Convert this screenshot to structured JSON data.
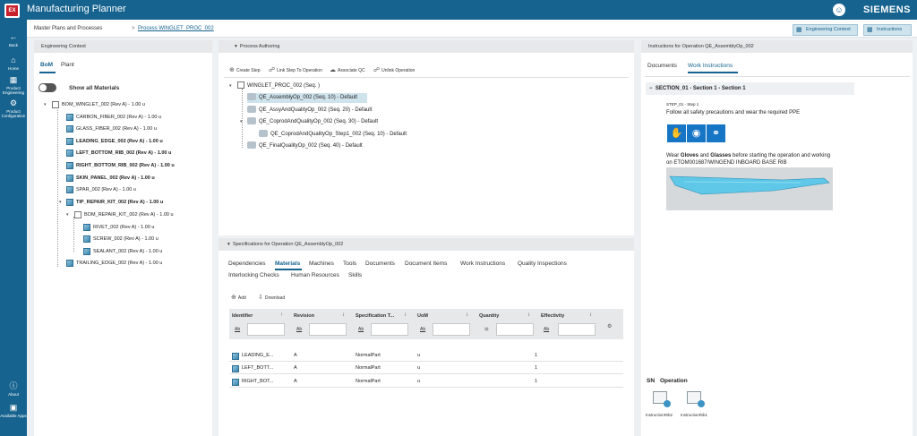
{
  "app": {
    "logo_text": "EX",
    "title": "Manufacturing Planner",
    "brand": "SIEMENS",
    "user_icon": "user-icon"
  },
  "rail": {
    "back": "Back",
    "home": "Home",
    "product_engineering": "Product Engineering",
    "product_configuration": "Product Configuration",
    "about": "About",
    "available_apps": "Available Apps"
  },
  "breadcrumb": {
    "root": "Master Plans and Processes",
    "separator": ">",
    "current": "Process WINGLET_PROC_002"
  },
  "top_buttons": {
    "engineering_context": "Engineering Context",
    "instructions": "Instructions"
  },
  "engineering_context": {
    "title": "Engineering Context",
    "tabs": [
      "BoM",
      "Plant"
    ],
    "active_tab": "BoM",
    "show_all_materials": "Show all Materials",
    "tree": [
      "BOM_WINGLET_002 (Rev A) - 1.00 u",
      "CARBON_FIBER_002 (Rev A) - 1.00 u",
      "GLASS_FIBER_002 (Rev A) - 1.00 u",
      "LEADING_EDGE_002 (Rev A) - 1.00 u",
      "LEFT_BOTTOM_RIB_002 (Rev A) - 1.00 u",
      "RIGHT_BOTTOM_RIB_002 (Rev A) - 1.00 u",
      "SKIN_PANEL_002 (Rev A) - 1.00 u",
      "SPAR_002 (Rev A) - 1.00 u",
      "TIP_REPAIR_KIT_002 (Rev A) - 1.00 u",
      "BOM_REPAIR_KIT_002 (Rev A) - 1.00 u",
      "RIVET_002 (Rev A) - 1.00 u",
      "SCREW_002 (Rev A) - 1.00 u",
      "SEALANT_002 (Rev A) - 1.00 u",
      "TRAILING_EDGE_002 (Rev A) - 1.00 u"
    ]
  },
  "process_authoring": {
    "title": "Process Authoring",
    "toolbar": [
      "Create Step",
      "Link Step To Operation",
      "Associate QC",
      "Unlink Operation"
    ],
    "tree": [
      "WINGLET_PROC_002 (Seq. )",
      "QE_AssemblyOp_002 (Seq. 10) - Default",
      "QE_AssyAndQualityOp_002 (Seq. 20) - Default",
      "QE_CoprodAndQualityOp_002 (Seq. 30) - Default",
      "QE_CoprodAndQualityOp_Step1_002 (Seq. 10) - Default",
      "QE_FinalQualityOp_002 (Seq. 40) - Default"
    ]
  },
  "specifications": {
    "title": "Specifications for Operation QE_AssemblyOp_002",
    "tabs": [
      "Dependencies",
      "Materials",
      "Machines",
      "Tools",
      "Documents",
      "Document Items",
      "Work Instructions",
      "Quality Inspections",
      "Interlocking Checks",
      "Human Resources",
      "Skills"
    ],
    "active_tab": "Materials",
    "actions": [
      "Add",
      "Download"
    ],
    "filter_label": "Ab",
    "columns": [
      "Identifier",
      "Revision",
      "Specification T...",
      "UoM",
      "Quantity",
      "Effectivity"
    ],
    "rows": [
      [
        "LEADING_E...",
        "A",
        "NormalPart",
        "u",
        "1",
        ""
      ],
      [
        "LEFT_BOTT...",
        "A",
        "NormalPart",
        "u",
        "1",
        ""
      ],
      [
        "RIGHT_BOT...",
        "A",
        "NormalPart",
        "u",
        "1",
        ""
      ]
    ]
  },
  "instructions": {
    "title": "Instructions for Operation QE_AssemblyOp_002",
    "tabs": [
      "Documents",
      "Work Instructions"
    ],
    "active_tab": "Work Instructions",
    "section": "SECTION_01 - Section 1 - Section 1",
    "step_label": "STEP_01 - Step 1",
    "step_text": "Follow all safety precautions and wear the required PPE",
    "wear_prefix": "Wear ",
    "wear_gloves": "Gloves",
    "wear_and": " and ",
    "wear_glasses": "Glasses",
    "wear_suffix": " before starting the operation and working",
    "wear_line2": "on ETOM001687/WINGEND INBOARD BASE RIB",
    "sn_label": "SN",
    "operation_label": "Operation",
    "instruction_items": [
      "InstructionRib2",
      "InstructionRib1"
    ]
  },
  "colors": {
    "brand_blue": "#16638f",
    "selection": "#cfe3ec",
    "safety_blue": "#1775c6"
  }
}
